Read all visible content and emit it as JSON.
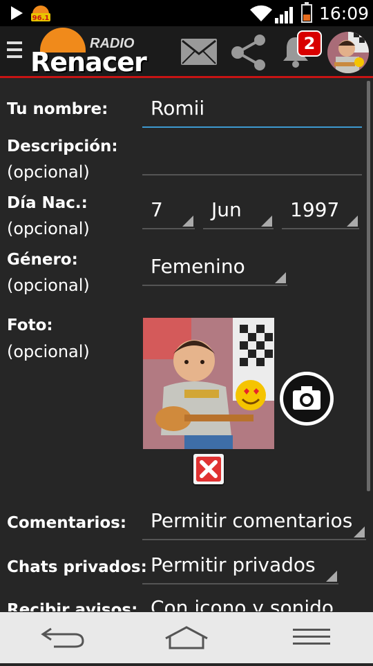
{
  "status_bar": {
    "time": "16:09",
    "icons": [
      "play-icon",
      "radio-renacer-logo",
      "wifi-icon",
      "signal-icon",
      "battery-icon"
    ],
    "mini_logo_text": "96.1"
  },
  "header": {
    "brand_top": "RADIO",
    "brand_name": "Renacer",
    "notification_count": "2",
    "accent_color": "#c81414",
    "icons": [
      "menu-icon",
      "mail-icon",
      "share-icon",
      "bell-icon"
    ]
  },
  "form": {
    "name": {
      "label": "Tu nombre:",
      "value": "Romii"
    },
    "description": {
      "label": "Descripción:",
      "sub": "(opcional)",
      "value": ""
    },
    "birth": {
      "label": "Día Nac.:",
      "sub": "(opcional)",
      "day": "7",
      "month": "Jun",
      "year": "1997"
    },
    "gender": {
      "label": "Género:",
      "sub": "(opcional)",
      "value": "Femenino"
    },
    "photo": {
      "label": "Foto:",
      "sub": "(opcional)"
    },
    "comments": {
      "label": "Comentarios:",
      "value": "Permitir comentarios"
    },
    "private_chats": {
      "label": "Chats privados:",
      "value": "Permitir privados"
    },
    "alerts": {
      "label": "Recibir avisos:",
      "value": "Con icono y sonido"
    }
  },
  "navbar": {
    "icons": [
      "back-icon",
      "home-icon",
      "menu-lines-icon"
    ]
  }
}
